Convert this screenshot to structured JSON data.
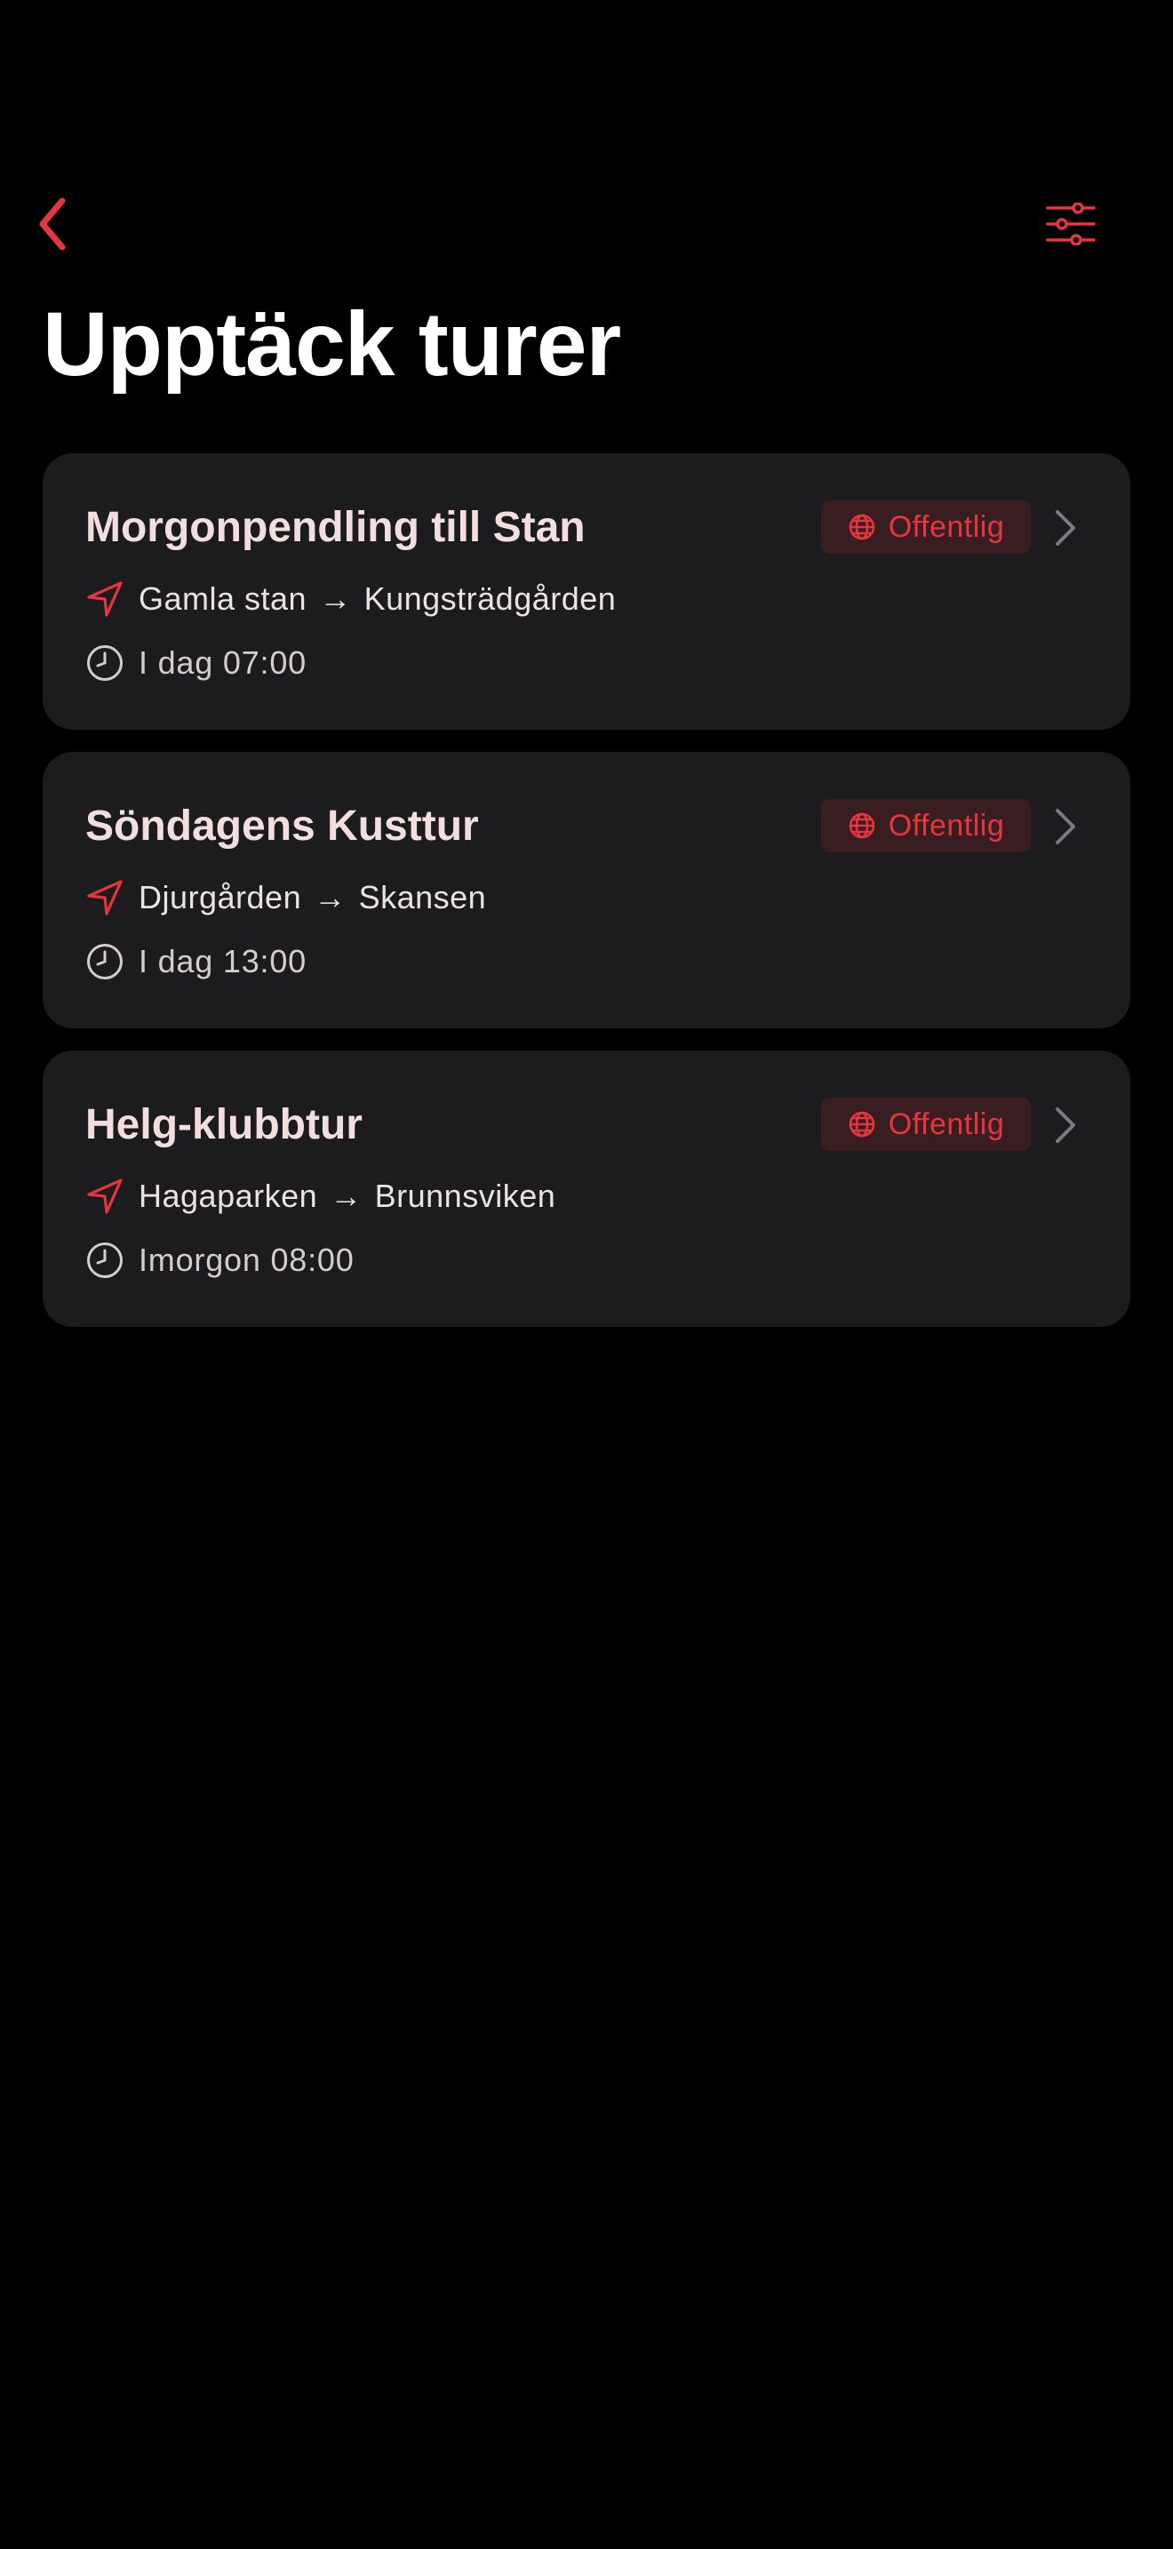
{
  "nav": {
    "back_icon": "chevron-left-icon",
    "filter_icon": "sliders-icon",
    "accent_color": "#e5363e"
  },
  "title": "Upptäck turer",
  "trips": [
    {
      "title": "Morgonpendling till Stan",
      "badge": "Offentlig",
      "from": "Gamla stan",
      "arrow": "→",
      "to": "Kungsträdgården",
      "time": "I dag 07:00"
    },
    {
      "title": "Söndagens Kusttur",
      "badge": "Offentlig",
      "from": "Djurgården",
      "arrow": "→",
      "to": "Skansen",
      "time": "I dag 13:00"
    },
    {
      "title": "Helg-klubbtur",
      "badge": "Offentlig",
      "from": "Hagaparken",
      "arrow": "→",
      "to": "Brunnsviken",
      "time": "Imorgon 08:00"
    }
  ],
  "icons": {
    "badge": "globe-icon",
    "route": "navigation-arrow-icon",
    "time": "clock-icon",
    "disclosure": "chevron-right-icon"
  },
  "colors": {
    "background": "#000000",
    "card": "#1c1c1e",
    "accent": "#e5363e",
    "badge_background": "#3a1d20",
    "title_text": "#f2dede"
  }
}
